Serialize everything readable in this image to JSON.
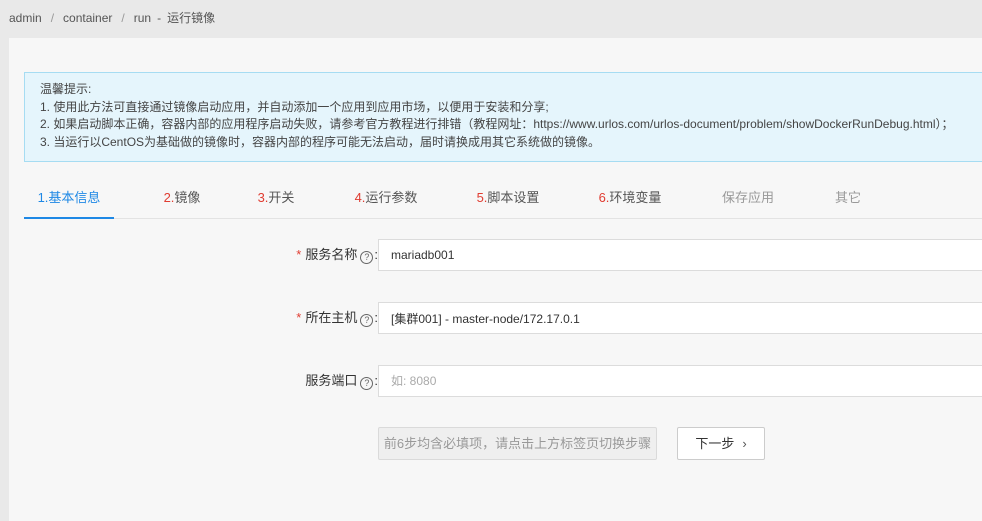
{
  "breadcrumb": {
    "items": [
      "admin",
      "container",
      "run"
    ],
    "separator": "/",
    "dash": "-",
    "current": "运行镜像"
  },
  "notice": {
    "title": "温馨提示:",
    "lines": [
      "1. 使用此方法可直接通过镜像启动应用，并自动添加一个应用到应用市场，以便用于安装和分享;",
      "2. 如果启动脚本正确，容器内部的应用程序启动失败，请参考官方教程进行排错（教程网址：https://www.urlos.com/urlos-document/problem/showDockerRunDebug.html）；",
      "3. 当运行以CentOS为基础做的镜像时，容器内部的程序可能无法启动，届时请换成用其它系统做的镜像。"
    ]
  },
  "tabs": [
    {
      "num": "1.",
      "label": "基本信息"
    },
    {
      "num": "2.",
      "label": "镜像"
    },
    {
      "num": "3.",
      "label": "开关"
    },
    {
      "num": "4.",
      "label": "运行参数"
    },
    {
      "num": "5.",
      "label": "脚本设置"
    },
    {
      "num": "6.",
      "label": "环境变量"
    },
    {
      "num": "",
      "label": "保存应用"
    },
    {
      "num": "",
      "label": "其它"
    }
  ],
  "form": {
    "service_name": {
      "required": "*",
      "label": "服务名称",
      "help": "?",
      "colon": ":",
      "value": "mariadb001"
    },
    "host": {
      "required": "*",
      "label": "所在主机",
      "help": "?",
      "colon": ":",
      "value": "[集群001] - master-node/172.17.0.1"
    },
    "port": {
      "label": "服务端口",
      "help": "?",
      "colon": ":",
      "value": "",
      "placeholder": "如: 8080"
    }
  },
  "buttons": {
    "hint": "前6步均含必填项，请点击上方标签页切换步骤",
    "next": "下一步",
    "next_icon": "chevron-right-icon"
  },
  "colors": {
    "accent": "#1e88e5",
    "required": "#e03c31",
    "notice_bg": "#e5f5fc",
    "notice_border": "#a6dcf2"
  }
}
